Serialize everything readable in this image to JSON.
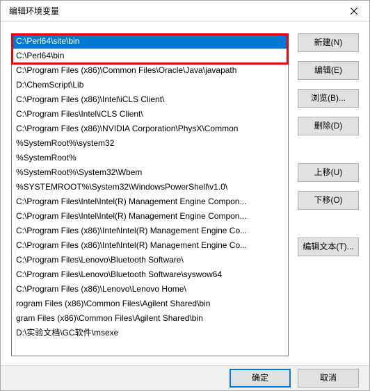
{
  "window": {
    "title": "编辑环境变量"
  },
  "list": {
    "items": [
      "C:\\Perl64\\site\\bin",
      "C:\\Perl64\\bin",
      "C:\\Program Files (x86)\\Common Files\\Oracle\\Java\\javapath",
      "D:\\ChemScript\\Lib",
      "C:\\Program Files (x86)\\Intel\\iCLS Client\\",
      "C:\\Program Files\\Intel\\iCLS Client\\",
      "C:\\Program Files (x86)\\NVIDIA Corporation\\PhysX\\Common",
      "%SystemRoot%\\system32",
      "%SystemRoot%",
      "%SystemRoot%\\System32\\Wbem",
      "%SYSTEMROOT%\\System32\\WindowsPowerShell\\v1.0\\",
      "C:\\Program Files\\Intel\\Intel(R) Management Engine Compon...",
      "C:\\Program Files\\Intel\\Intel(R) Management Engine Compon...",
      "C:\\Program Files (x86)\\Intel\\Intel(R) Management Engine Co...",
      "C:\\Program Files (x86)\\Intel\\Intel(R) Management Engine Co...",
      "C:\\Program Files\\Lenovo\\Bluetooth Software\\",
      "C:\\Program Files\\Lenovo\\Bluetooth Software\\syswow64",
      "C:\\Program Files (x86)\\Lenovo\\Lenovo Home\\",
      "rogram Files (x86)\\Common Files\\Agilent Shared\\bin",
      "gram Files (x86)\\Common Files\\Agilent Shared\\bin",
      "D:\\实验文档\\GC软件\\msexe"
    ],
    "selected_index": 0
  },
  "buttons": {
    "new": "新建(N)",
    "edit": "编辑(E)",
    "browse": "浏览(B)...",
    "delete": "删除(D)",
    "move_up": "上移(U)",
    "move_down": "下移(O)",
    "edit_text": "编辑文本(T)...",
    "ok": "确定",
    "cancel": "取消"
  }
}
